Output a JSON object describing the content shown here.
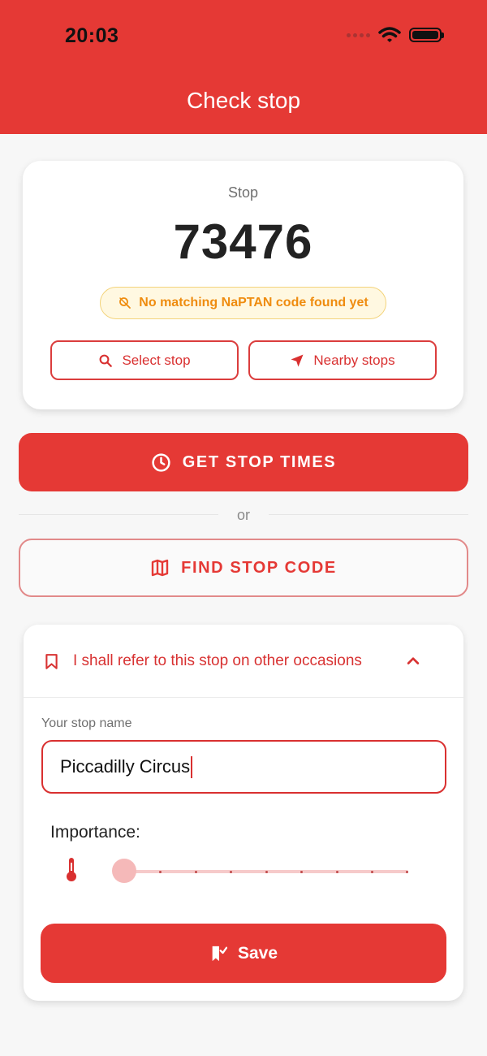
{
  "status_bar": {
    "time": "20:03"
  },
  "header": {
    "title": "Check stop"
  },
  "stop": {
    "label": "Stop",
    "code": "73476",
    "notice": "No matching NaPTAN code found yet",
    "select_label": "Select stop",
    "nearby_label": "Nearby stops"
  },
  "actions": {
    "get_times_label": "GET STOP TIMES",
    "divider_label": "or",
    "find_code_label": "FIND STOP CODE"
  },
  "save_section": {
    "header_label": "I shall refer to this stop on other occasions",
    "field_label": "Your stop name",
    "field_value": "Piccadilly Circus",
    "importance_label": "Importance:",
    "importance_value": 0,
    "save_label": "Save"
  },
  "icons": {
    "accent": "#e53935",
    "notice_bg": "#fff8e1",
    "notice_text": "#ef8c0f",
    "icon_names": [
      "signal-icon",
      "wifi-icon",
      "battery-icon",
      "search-icon",
      "navigation-icon",
      "clock-icon",
      "map-icon",
      "bookmark-icon",
      "chevron-up-icon",
      "thermometer-icon",
      "save-bookmark-icon"
    ]
  }
}
